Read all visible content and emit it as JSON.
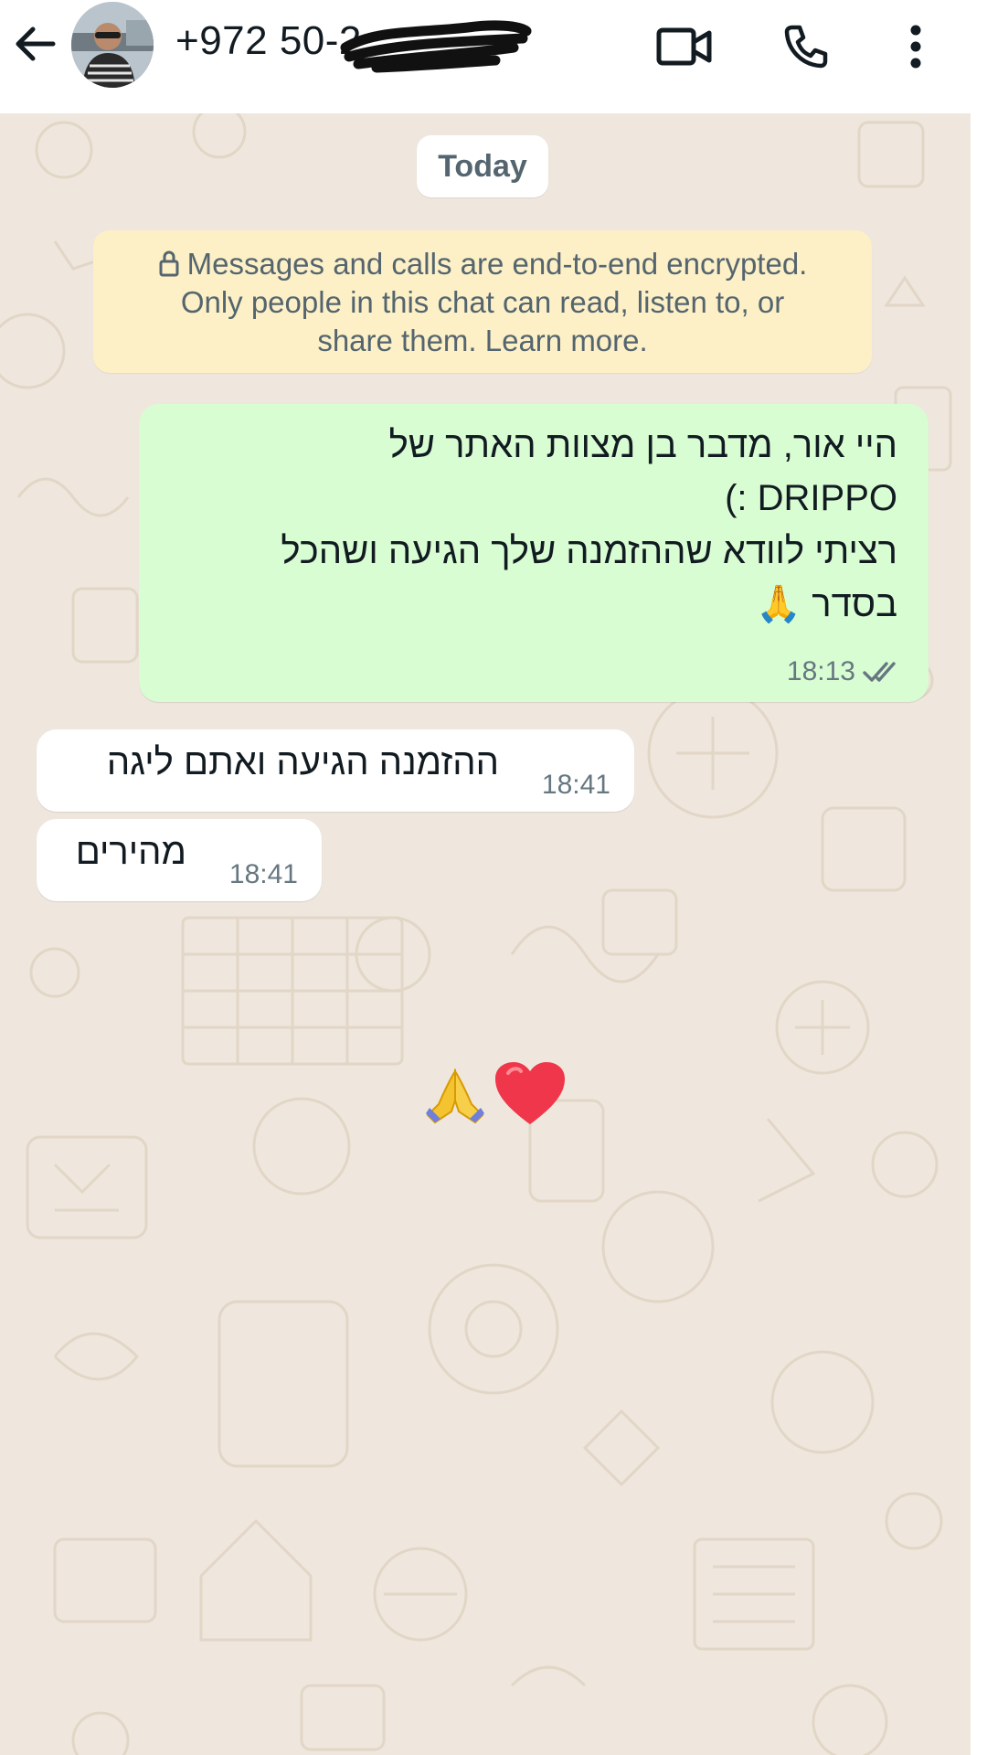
{
  "header": {
    "contact_name": "+972 50-2",
    "icons": {
      "back": "arrow-left-icon",
      "video": "video-camera-icon",
      "call": "phone-icon",
      "menu": "more-vertical-icon"
    }
  },
  "chat": {
    "date_label": "Today",
    "encryption_notice": {
      "line1": "Messages and calls are end-to-end encrypted.",
      "line2": "Only people in this chat can read, listen to, or",
      "line3": "share them. Learn more."
    },
    "messages": [
      {
        "direction": "outgoing",
        "lines": [
          "היי אור, מדבר בן מצוות האתר של",
          "DRIPPO :)",
          "רציתי לוודא שההזמנה שלך הגיעה ושהכל",
          "בסדר 🙏"
        ],
        "time": "18:13",
        "status": "read-double-check-icon"
      },
      {
        "direction": "incoming",
        "text": "ההזמנה הגיעה ואתם ליגה",
        "time": "18:41"
      },
      {
        "direction": "incoming",
        "text": "מהירים",
        "time": "18:41"
      }
    ],
    "emoji_message": "🙏❤️"
  },
  "colors": {
    "chat_background": "#efe7dd",
    "outgoing_bubble": "#d9fdd3",
    "incoming_bubble": "#ffffff",
    "encryption_notice_bg": "#fdf0c6",
    "secondary_text": "#667781"
  }
}
